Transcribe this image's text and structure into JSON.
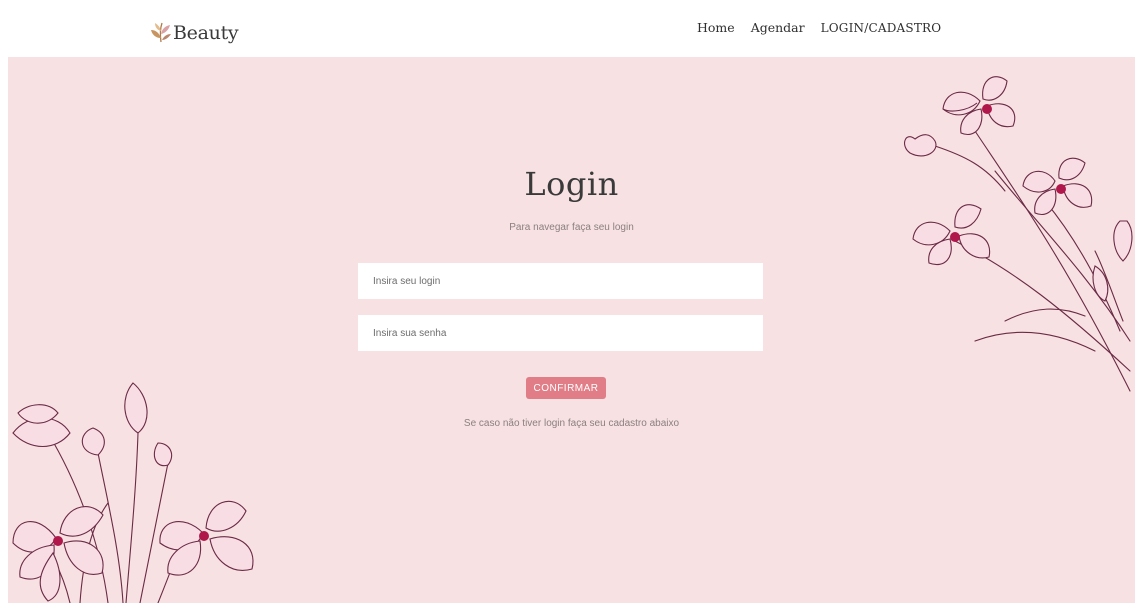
{
  "header": {
    "logo_text": "Beauty",
    "nav": {
      "home": "Home",
      "agendar": "Agendar",
      "login_cadastro": "LOGIN/CADASTRO"
    }
  },
  "login": {
    "title": "Login",
    "subtitle": "Para navegar faça seu login",
    "login_placeholder": "Insira seu login",
    "senha_placeholder": "Insira sua senha",
    "confirm_label": "CONFIRMAR",
    "signup_note": "Se caso não tiver login faça seu cadastro abaixo"
  },
  "colors": {
    "background": "#f7e1e2",
    "accent": "#e07d86",
    "flower_line": "#6b2a45",
    "flower_fill": "#f3c6d0"
  },
  "icons": {
    "logo": "leaf-logo-icon",
    "decor_right": "flower-bouquet-icon",
    "decor_left": "flower-bouquet-icon"
  }
}
